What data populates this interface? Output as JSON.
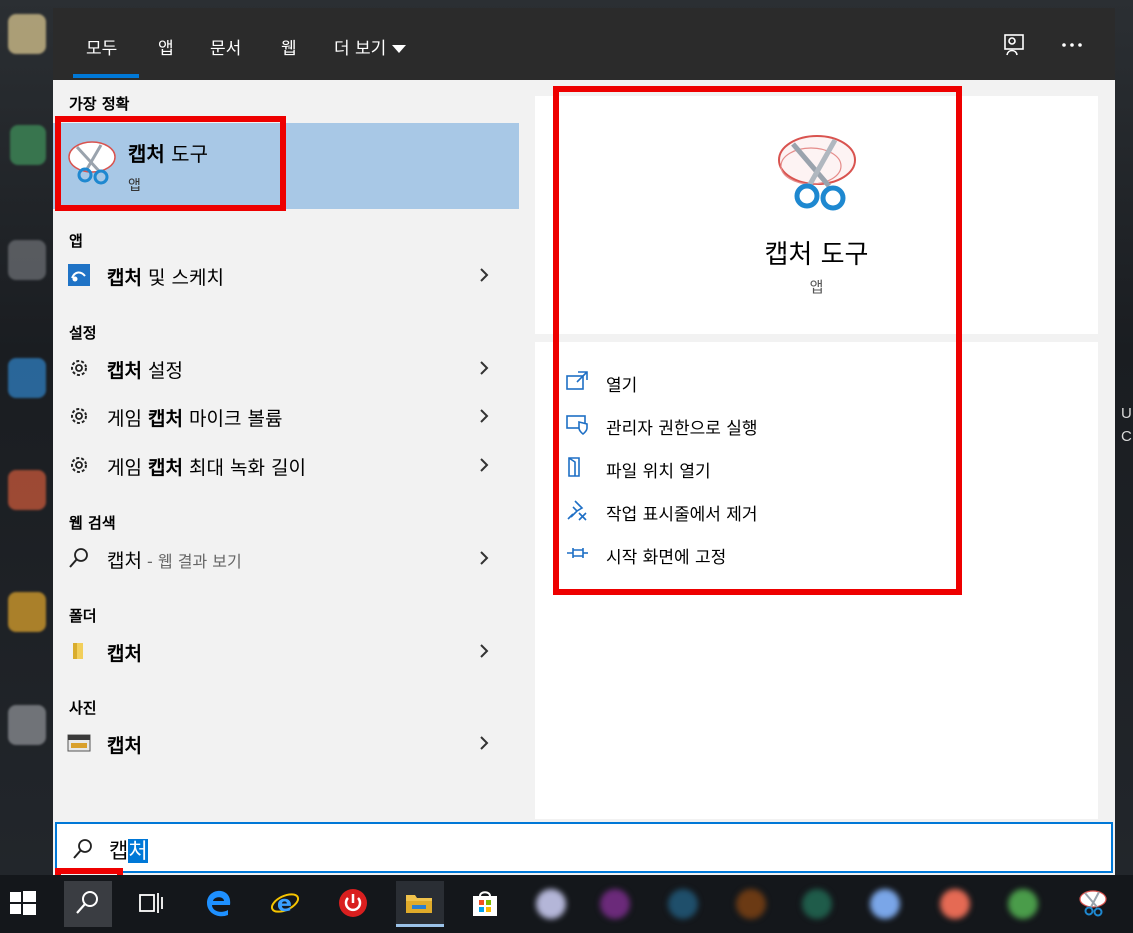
{
  "tabs": [
    {
      "label": "모두"
    },
    {
      "label": "앱"
    },
    {
      "label": "문서"
    },
    {
      "label": "웹"
    },
    {
      "label": "더 보기"
    }
  ],
  "sections": {
    "best_match": "가장 정확",
    "apps": "앱",
    "settings": "설정",
    "web": "웹 검색",
    "folders": "폴더",
    "photos": "사진"
  },
  "best_match": {
    "bold": "캡처",
    "rest": " 도구",
    "subtitle": "앱"
  },
  "rows": {
    "app_snip": {
      "bold": "캡처",
      "rest": " 및 스케치"
    },
    "setting_capture": {
      "bold": "캡처",
      "rest": " 설정"
    },
    "setting_game_mic": {
      "pre": "게임 ",
      "bold": "캡처",
      "rest": " 마이크 볼륨"
    },
    "setting_game_max": {
      "pre": "게임 ",
      "bold": "캡처",
      "rest": " 최대 녹화 길이"
    },
    "web_search": {
      "query": "캡처",
      "hint": " - 웹 결과 보기"
    },
    "folder_capture": {
      "bold": "캡처"
    },
    "photo_capture": {
      "bold": "캡처"
    }
  },
  "detail": {
    "title": "캡처 도구",
    "subtitle": "앱",
    "actions": [
      {
        "label": "열기",
        "icon": "open-icon"
      },
      {
        "label": "관리자 권한으로 실행",
        "icon": "shield-icon"
      },
      {
        "label": "파일 위치 열기",
        "icon": "file-location-icon"
      },
      {
        "label": "작업 표시줄에서 제거",
        "icon": "unpin-icon"
      },
      {
        "label": "시작 화면에 고정",
        "icon": "pin-icon"
      }
    ]
  },
  "search": {
    "typed": "캡",
    "selected": "처"
  },
  "desktop_side_text": [
    "U",
    "C"
  ],
  "colors": {
    "accent": "#0078d7",
    "highlight": "#a8c8e6",
    "annotation": "#ee0000",
    "tabbar": "#2b2b2b"
  }
}
